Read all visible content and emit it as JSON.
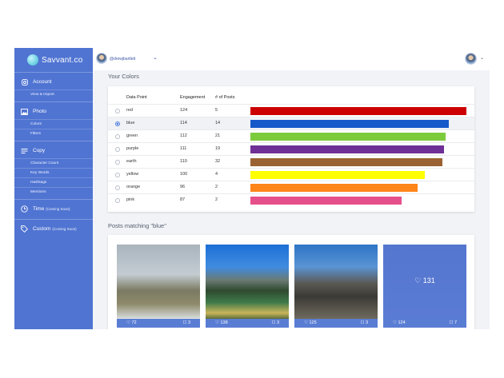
{
  "sidebar": {
    "brand": "Savvant.co",
    "sections": [
      {
        "label": "Account",
        "note": "",
        "icon": "instagram-icon",
        "subs": [
          "View & Import"
        ]
      },
      {
        "label": "Photo",
        "note": "",
        "icon": "image-icon",
        "subs": [
          "Colors",
          "Filters"
        ]
      },
      {
        "label": "Copy",
        "note": "",
        "icon": "text-lines-icon",
        "subs": [
          "Character Count",
          "Key Words",
          "Hashtags",
          "Mentions"
        ]
      },
      {
        "label": "Time",
        "note": "(Coming Soon)",
        "icon": "clock-icon",
        "subs": []
      },
      {
        "label": "Custom",
        "note": "(Coming Soon)",
        "icon": "tag-icon",
        "subs": []
      }
    ]
  },
  "topbar": {
    "handle": "@drewjbartlett"
  },
  "colors_section": {
    "heading": "Your Colors",
    "headers": {
      "point": "Data Point",
      "engagement": "Engagement",
      "posts": "# of Posts"
    },
    "max_engagement": 124,
    "rows": [
      {
        "name": "red",
        "engagement": "124",
        "posts": "5",
        "value": 124,
        "color": "#cc0000",
        "selected": false
      },
      {
        "name": "blue",
        "engagement": "114",
        "posts": "14",
        "value": 114,
        "color": "#1558c9",
        "selected": true
      },
      {
        "name": "green",
        "engagement": "112",
        "posts": "21",
        "value": 112,
        "color": "#7ccb3b",
        "selected": false
      },
      {
        "name": "purple",
        "engagement": "111",
        "posts": "19",
        "value": 111,
        "color": "#6e2f96",
        "selected": false
      },
      {
        "name": "earth",
        "engagement": "110",
        "posts": "32",
        "value": 110,
        "color": "#9a6232",
        "selected": false
      },
      {
        "name": "yellow",
        "engagement": "100",
        "posts": "4",
        "value": 100,
        "color": "#ffff00",
        "selected": false
      },
      {
        "name": "orange",
        "engagement": "96",
        "posts": "2",
        "value": 96,
        "color": "#ff8419",
        "selected": false
      },
      {
        "name": "pink",
        "engagement": "87",
        "posts": "2",
        "value": 87,
        "color": "#e6508a",
        "selected": false
      }
    ]
  },
  "posts_section": {
    "heading": "Posts matching \"blue\"",
    "posts": [
      {
        "likes": "72",
        "comments": "3",
        "scene": "plains"
      },
      {
        "likes": "138",
        "comments": "3",
        "scene": "lake"
      },
      {
        "likes": "125",
        "comments": "3",
        "scene": "hiker"
      },
      {
        "likes": "124",
        "comments": "7",
        "scene": "overlay",
        "overlay_likes": "131"
      }
    ]
  }
}
